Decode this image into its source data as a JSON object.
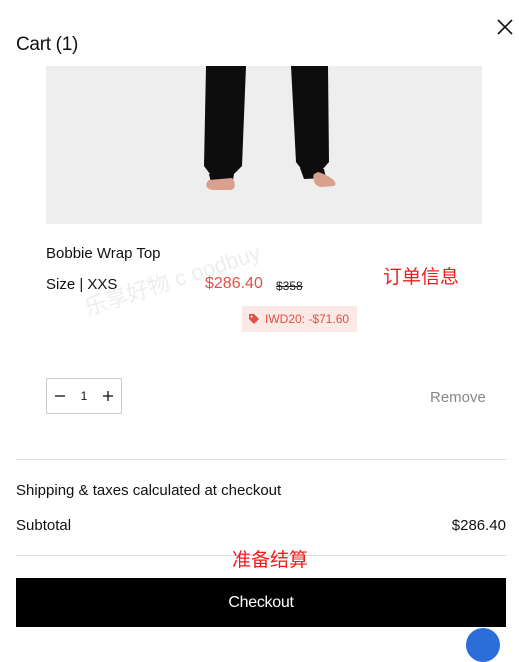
{
  "header": {
    "cart_title": "Cart (1)",
    "close_icon": "close-icon"
  },
  "item": {
    "name": "Bobbie Wrap Top",
    "size_label": "Size | XXS",
    "sale_price": "$286.40",
    "original_price": "$358",
    "discount_text": "IWD20: -$71.60",
    "discount_icon": "tag-icon",
    "quantity": "1",
    "remove_label": "Remove"
  },
  "summary": {
    "shipping_note": "Shipping & taxes calculated at checkout",
    "subtotal_label": "Subtotal",
    "subtotal_value": "$286.40"
  },
  "checkout": {
    "label": "Checkout"
  },
  "annotations": {
    "order_info": "订单信息",
    "ready_checkout": "准备结算"
  },
  "watermark": "乐享好物 c  oodbuy",
  "colors": {
    "accent_red": "#e15044",
    "button_bg": "#000000",
    "annotation_red": "#ee1c1c"
  }
}
